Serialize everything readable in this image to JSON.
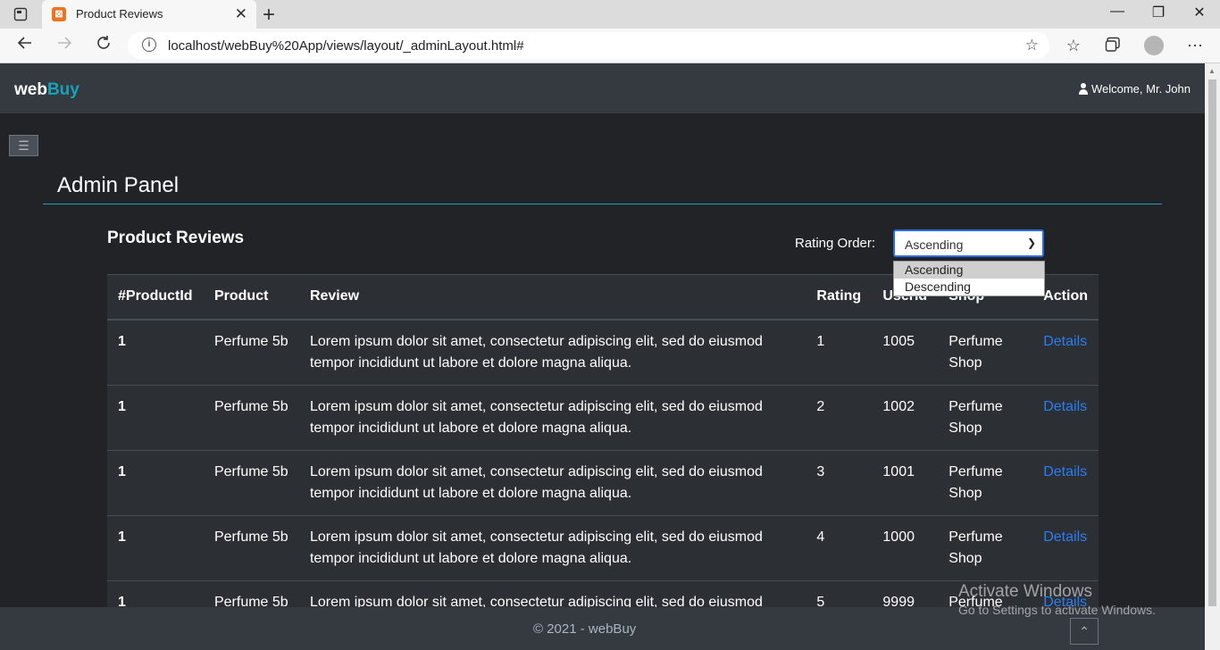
{
  "browser": {
    "tab_title": "Product Reviews",
    "tab_close": "✕",
    "new_tab": "+",
    "url": "localhost/webBuy%20App/views/layout/_adminLayout.html#",
    "window_controls": [
      "—",
      "❐",
      "✕"
    ],
    "icons": [
      "back-arrow-icon",
      "forward-arrow-icon",
      "refresh-icon",
      "info-icon",
      "add-favorite-icon",
      "favorites-icon",
      "collections-icon",
      "profile-icon",
      "more-icon"
    ]
  },
  "header": {
    "brand_main": "web",
    "brand_accent": "Buy",
    "welcome": "Welcome, Mr. John"
  },
  "page": {
    "admin_title": "Admin Panel",
    "reviews_title": "Product Reviews",
    "rating_label": "Rating Order:",
    "rating_selected": "Ascending",
    "rating_options": [
      "Ascending",
      "Descending"
    ]
  },
  "table": {
    "headers": [
      "#ProductId",
      "Product",
      "Review",
      "Rating",
      "UserId",
      "Shop",
      "Action"
    ],
    "rows": [
      {
        "pid": "1",
        "product": "Perfume 5b",
        "review": "Lorem ipsum dolor sit amet, consectetur adipiscing elit, sed do eiusmod tempor incididunt ut labore et dolore magna aliqua.",
        "rating": "1",
        "userid": "1005",
        "shop": "Perfume Shop",
        "action": "Details"
      },
      {
        "pid": "1",
        "product": "Perfume 5b",
        "review": "Lorem ipsum dolor sit amet, consectetur adipiscing elit, sed do eiusmod tempor incididunt ut labore et dolore magna aliqua.",
        "rating": "2",
        "userid": "1002",
        "shop": "Perfume Shop",
        "action": "Details"
      },
      {
        "pid": "1",
        "product": "Perfume 5b",
        "review": "Lorem ipsum dolor sit amet, consectetur adipiscing elit, sed do eiusmod tempor incididunt ut labore et dolore magna aliqua.",
        "rating": "3",
        "userid": "1001",
        "shop": "Perfume Shop",
        "action": "Details"
      },
      {
        "pid": "1",
        "product": "Perfume 5b",
        "review": "Lorem ipsum dolor sit amet, consectetur adipiscing elit, sed do eiusmod tempor incididunt ut labore et dolore magna aliqua.",
        "rating": "4",
        "userid": "1000",
        "shop": "Perfume Shop",
        "action": "Details"
      },
      {
        "pid": "1",
        "product": "Perfume 5b",
        "review": "Lorem ipsum dolor sit amet, consectetur adipiscing elit, sed do eiusmod tempor incididunt ut labore et dolore magna aliqua.",
        "rating": "5",
        "userid": "9999",
        "shop": "Perfume Shop",
        "action": "Details"
      }
    ]
  },
  "footer": {
    "copyright": "© 2021 - webBuy"
  },
  "watermark": {
    "line1": "Activate Windows",
    "line2": "Go to Settings to activate Windows."
  },
  "colors": {
    "accent": "#17a2b8",
    "header_bg": "#343a40",
    "body_bg": "#222326",
    "link": "#2a7df2"
  }
}
